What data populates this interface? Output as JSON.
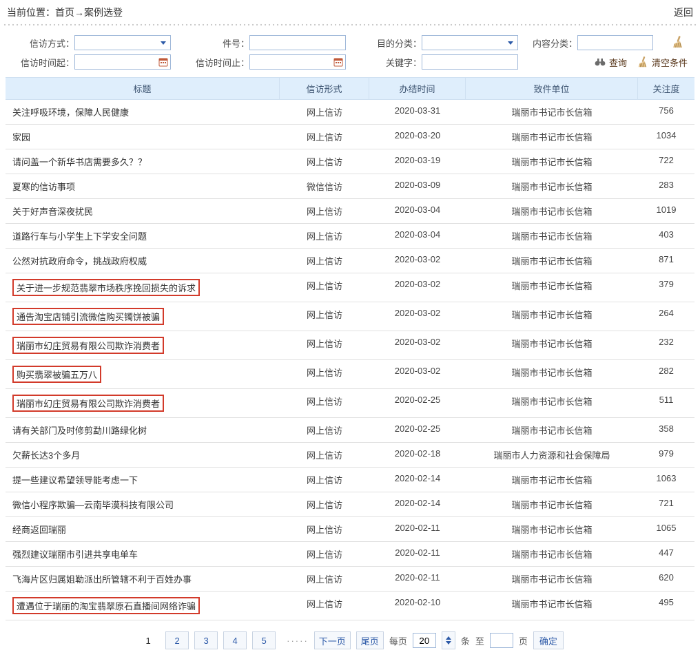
{
  "breadcrumb": {
    "prefix": "当前位置：",
    "home": "首页",
    "arrow": "→",
    "page": "案例选登",
    "back": "返回"
  },
  "filter": {
    "method_label": "信访方式：",
    "number_label": "件号：",
    "purpose_label": "目的分类：",
    "content_label": "内容分类：",
    "time_from_label": "信访时间起：",
    "time_to_label": "信访时间止：",
    "keyword_label": "关键字：",
    "search": "查询",
    "clear": "清空条件"
  },
  "columns": {
    "title": "标题",
    "form": "信访形式",
    "done": "办结时间",
    "unit": "致件单位",
    "attention": "关注度"
  },
  "rows": [
    {
      "title": "关注呼吸环境，保障人民健康",
      "hl": false,
      "form": "网上信访",
      "done": "2020-03-31",
      "unit": "瑞丽市书记市长信箱",
      "attention": "756"
    },
    {
      "title": "家园",
      "hl": false,
      "form": "网上信访",
      "done": "2020-03-20",
      "unit": "瑞丽市书记市长信箱",
      "attention": "1034"
    },
    {
      "title": "请问盖一个新华书店需要多久？？",
      "hl": false,
      "form": "网上信访",
      "done": "2020-03-19",
      "unit": "瑞丽市书记市长信箱",
      "attention": "722"
    },
    {
      "title": "夏寒的信访事项",
      "hl": false,
      "form": "微信信访",
      "done": "2020-03-09",
      "unit": "瑞丽市书记市长信箱",
      "attention": "283"
    },
    {
      "title": "关于好声音深夜扰民",
      "hl": false,
      "form": "网上信访",
      "done": "2020-03-04",
      "unit": "瑞丽市书记市长信箱",
      "attention": "1019"
    },
    {
      "title": "道路行车与小学生上下学安全问题",
      "hl": false,
      "form": "网上信访",
      "done": "2020-03-04",
      "unit": "瑞丽市书记市长信箱",
      "attention": "403"
    },
    {
      "title": "公然对抗政府命令，挑战政府权威",
      "hl": false,
      "form": "网上信访",
      "done": "2020-03-02",
      "unit": "瑞丽市书记市长信箱",
      "attention": "871"
    },
    {
      "title": "关于进一步规范翡翠市场秩序挽回损失的诉求",
      "hl": true,
      "form": "网上信访",
      "done": "2020-03-02",
      "unit": "瑞丽市书记市长信箱",
      "attention": "379"
    },
    {
      "title": "通告淘宝店铺引流微信购买镯饼被骗",
      "hl": true,
      "form": "网上信访",
      "done": "2020-03-02",
      "unit": "瑞丽市书记市长信箱",
      "attention": "264"
    },
    {
      "title": "瑞丽市幻庄贸易有限公司欺诈消费者",
      "hl": true,
      "form": "网上信访",
      "done": "2020-03-02",
      "unit": "瑞丽市书记市长信箱",
      "attention": "232"
    },
    {
      "title": "购买翡翠被骗五万八",
      "hl": true,
      "form": "网上信访",
      "done": "2020-03-02",
      "unit": "瑞丽市书记市长信箱",
      "attention": "282"
    },
    {
      "title": "瑞丽市幻庄贸易有限公司欺诈消费者",
      "hl": true,
      "form": "网上信访",
      "done": "2020-02-25",
      "unit": "瑞丽市书记市长信箱",
      "attention": "511"
    },
    {
      "title": "请有关部门及时修剪勐川路绿化树",
      "hl": false,
      "form": "网上信访",
      "done": "2020-02-25",
      "unit": "瑞丽市书记市长信箱",
      "attention": "358"
    },
    {
      "title": "欠薪长达3个多月",
      "hl": false,
      "form": "网上信访",
      "done": "2020-02-18",
      "unit": "瑞丽市人力资源和社会保障局",
      "attention": "979"
    },
    {
      "title": "提一些建议希望领导能考虑一下",
      "hl": false,
      "form": "网上信访",
      "done": "2020-02-14",
      "unit": "瑞丽市书记市长信箱",
      "attention": "1063"
    },
    {
      "title": "微信小程序欺骗—云南毕漠科技有限公司",
      "hl": false,
      "form": "网上信访",
      "done": "2020-02-14",
      "unit": "瑞丽市书记市长信箱",
      "attention": "721"
    },
    {
      "title": "经商返回瑞丽",
      "hl": false,
      "form": "网上信访",
      "done": "2020-02-11",
      "unit": "瑞丽市书记市长信箱",
      "attention": "1065"
    },
    {
      "title": "强烈建议瑞丽市引进共享电单车",
      "hl": false,
      "form": "网上信访",
      "done": "2020-02-11",
      "unit": "瑞丽市书记市长信箱",
      "attention": "447"
    },
    {
      "title": "飞海片区归属姐勒派出所管辖不利于百姓办事",
      "hl": false,
      "form": "网上信访",
      "done": "2020-02-11",
      "unit": "瑞丽市书记市长信箱",
      "attention": "620"
    },
    {
      "title": "遭遇位于瑞丽的淘宝翡翠原石直播间网络诈骗",
      "hl": true,
      "form": "网上信访",
      "done": "2020-02-10",
      "unit": "瑞丽市书记市长信箱",
      "attention": "495"
    }
  ],
  "pagination": {
    "current": "1",
    "pages": [
      "2",
      "3",
      "4",
      "5"
    ],
    "ellipsis": "·····",
    "next": "下一页",
    "last": "尾页",
    "each": "每页",
    "per_value": "20",
    "per_unit": "条",
    "to": "至",
    "page_unit": "页",
    "go": "确定"
  }
}
